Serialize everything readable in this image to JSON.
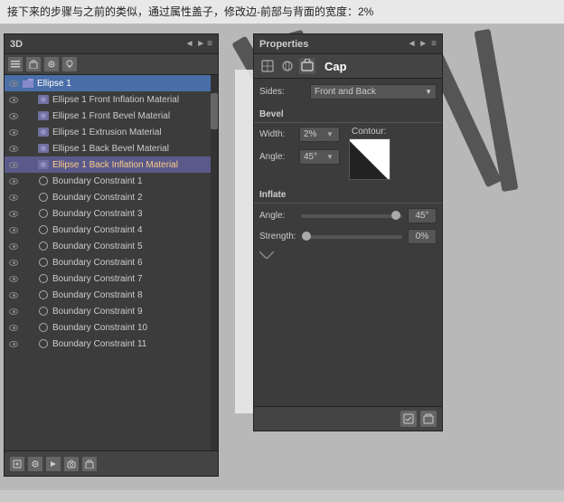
{
  "topbar": {
    "text": "接下来的步骤与之前的类似，通过属性盖子，修改边-前部与背面的宽度：2%"
  },
  "panel3d": {
    "title": "3D",
    "layers": [
      {
        "id": "ellipse1",
        "label": "Ellipse 1",
        "type": "folder",
        "selected": true,
        "indent": 0
      },
      {
        "id": "ellipse1-front-inflation",
        "label": "Ellipse 1 Front Inflation Material",
        "type": "material",
        "selected": false,
        "indent": 1
      },
      {
        "id": "ellipse1-front-bevel",
        "label": "Ellipse 1 Front Bevel Material",
        "type": "material",
        "selected": false,
        "indent": 1
      },
      {
        "id": "ellipse1-extrusion",
        "label": "Ellipse 1 Extrusion Material",
        "type": "material",
        "selected": false,
        "indent": 1
      },
      {
        "id": "ellipse1-back-bevel",
        "label": "Ellipse 1 Back Bevel Material",
        "type": "material",
        "selected": false,
        "indent": 1
      },
      {
        "id": "ellipse1-back-inflation",
        "label": "Ellipse 1 Back Inflation Material",
        "type": "material",
        "selected": false,
        "indent": 1,
        "highlighted": true
      },
      {
        "id": "boundary1",
        "label": "Boundary Constraint 1",
        "type": "circle",
        "selected": false,
        "indent": 1
      },
      {
        "id": "boundary2",
        "label": "Boundary Constraint 2",
        "type": "circle",
        "selected": false,
        "indent": 1
      },
      {
        "id": "boundary3",
        "label": "Boundary Constraint 3",
        "type": "circle",
        "selected": false,
        "indent": 1
      },
      {
        "id": "boundary4",
        "label": "Boundary Constraint 4",
        "type": "circle",
        "selected": false,
        "indent": 1
      },
      {
        "id": "boundary5",
        "label": "Boundary Constraint 5",
        "type": "circle",
        "selected": false,
        "indent": 1
      },
      {
        "id": "boundary6",
        "label": "Boundary Constraint 6",
        "type": "circle",
        "selected": false,
        "indent": 1
      },
      {
        "id": "boundary7",
        "label": "Boundary Constraint 7",
        "type": "circle",
        "selected": false,
        "indent": 1
      },
      {
        "id": "boundary8",
        "label": "Boundary Constraint 8",
        "type": "circle",
        "selected": false,
        "indent": 1
      },
      {
        "id": "boundary9",
        "label": "Boundary Constraint 9",
        "type": "circle",
        "selected": false,
        "indent": 1
      },
      {
        "id": "boundary10",
        "label": "Boundary Constraint 10",
        "type": "circle",
        "selected": false,
        "indent": 1
      },
      {
        "id": "boundary11",
        "label": "Boundary Constraint 11",
        "type": "circle",
        "selected": false,
        "indent": 1
      }
    ]
  },
  "properties": {
    "title": "Properties",
    "section": "Cap",
    "sides_label": "Sides:",
    "sides_value": "Front and Back",
    "bevel_label": "Bevel",
    "width_label": "Width:",
    "width_value": "2%",
    "contour_label": "Contour:",
    "angle_label": "Angle:",
    "angle_value": "45°",
    "inflate_label": "Inflate",
    "inflate_angle_label": "Angle:",
    "inflate_angle_value": "45°",
    "strength_label": "Strength:",
    "strength_value": "0%"
  }
}
